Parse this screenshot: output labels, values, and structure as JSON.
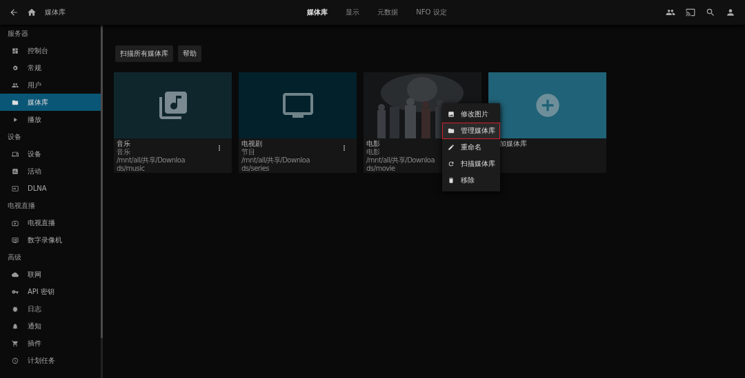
{
  "header": {
    "title": "媒体库",
    "tabs": [
      {
        "label": "媒体库",
        "selected": true
      },
      {
        "label": "显示",
        "selected": false
      },
      {
        "label": "元数据",
        "selected": false
      },
      {
        "label": "NFO 设定",
        "selected": false
      }
    ]
  },
  "sidebar": {
    "sections": [
      {
        "heading": "服务器",
        "items": [
          {
            "label": "控制台",
            "selected": false
          },
          {
            "label": "常规",
            "selected": false
          },
          {
            "label": "用户",
            "selected": false
          },
          {
            "label": "媒体库",
            "selected": true
          },
          {
            "label": "播放",
            "selected": false
          }
        ]
      },
      {
        "heading": "设备",
        "items": [
          {
            "label": "设备",
            "selected": false
          },
          {
            "label": "活动",
            "selected": false
          },
          {
            "label": "DLNA",
            "selected": false
          }
        ]
      },
      {
        "heading": "电视直播",
        "items": [
          {
            "label": "电视直播",
            "selected": false
          },
          {
            "label": "数字录像机",
            "selected": false
          }
        ]
      },
      {
        "heading": "高级",
        "items": [
          {
            "label": "联网",
            "selected": false
          },
          {
            "label": "API 密钥",
            "selected": false
          },
          {
            "label": "日志",
            "selected": false
          },
          {
            "label": "通知",
            "selected": false
          },
          {
            "label": "插件",
            "selected": false
          },
          {
            "label": "计划任务",
            "selected": false
          }
        ]
      }
    ]
  },
  "toolbar": {
    "buttons": [
      "扫描所有媒体库",
      "帮助"
    ]
  },
  "libraries": [
    {
      "kind": "music",
      "name": "音乐",
      "type": "音乐",
      "path": "/mnt/all/共享/Downloads/music"
    },
    {
      "kind": "tv",
      "name": "电视剧",
      "type": "节目",
      "path": "/mnt/all/共享/Downloads/series"
    },
    {
      "kind": "picture",
      "name": "电影",
      "type": "电影",
      "path": "/mnt/all/共享/Downloads/movie"
    },
    {
      "kind": "add",
      "name": "加媒体库"
    }
  ],
  "menu": {
    "items": [
      {
        "label": "修改图片",
        "selected": false
      },
      {
        "label": "管理媒体库",
        "selected": true
      },
      {
        "label": "重命名",
        "selected": false
      },
      {
        "label": "扫描媒体库",
        "selected": false
      },
      {
        "label": "移除",
        "selected": false
      }
    ]
  }
}
